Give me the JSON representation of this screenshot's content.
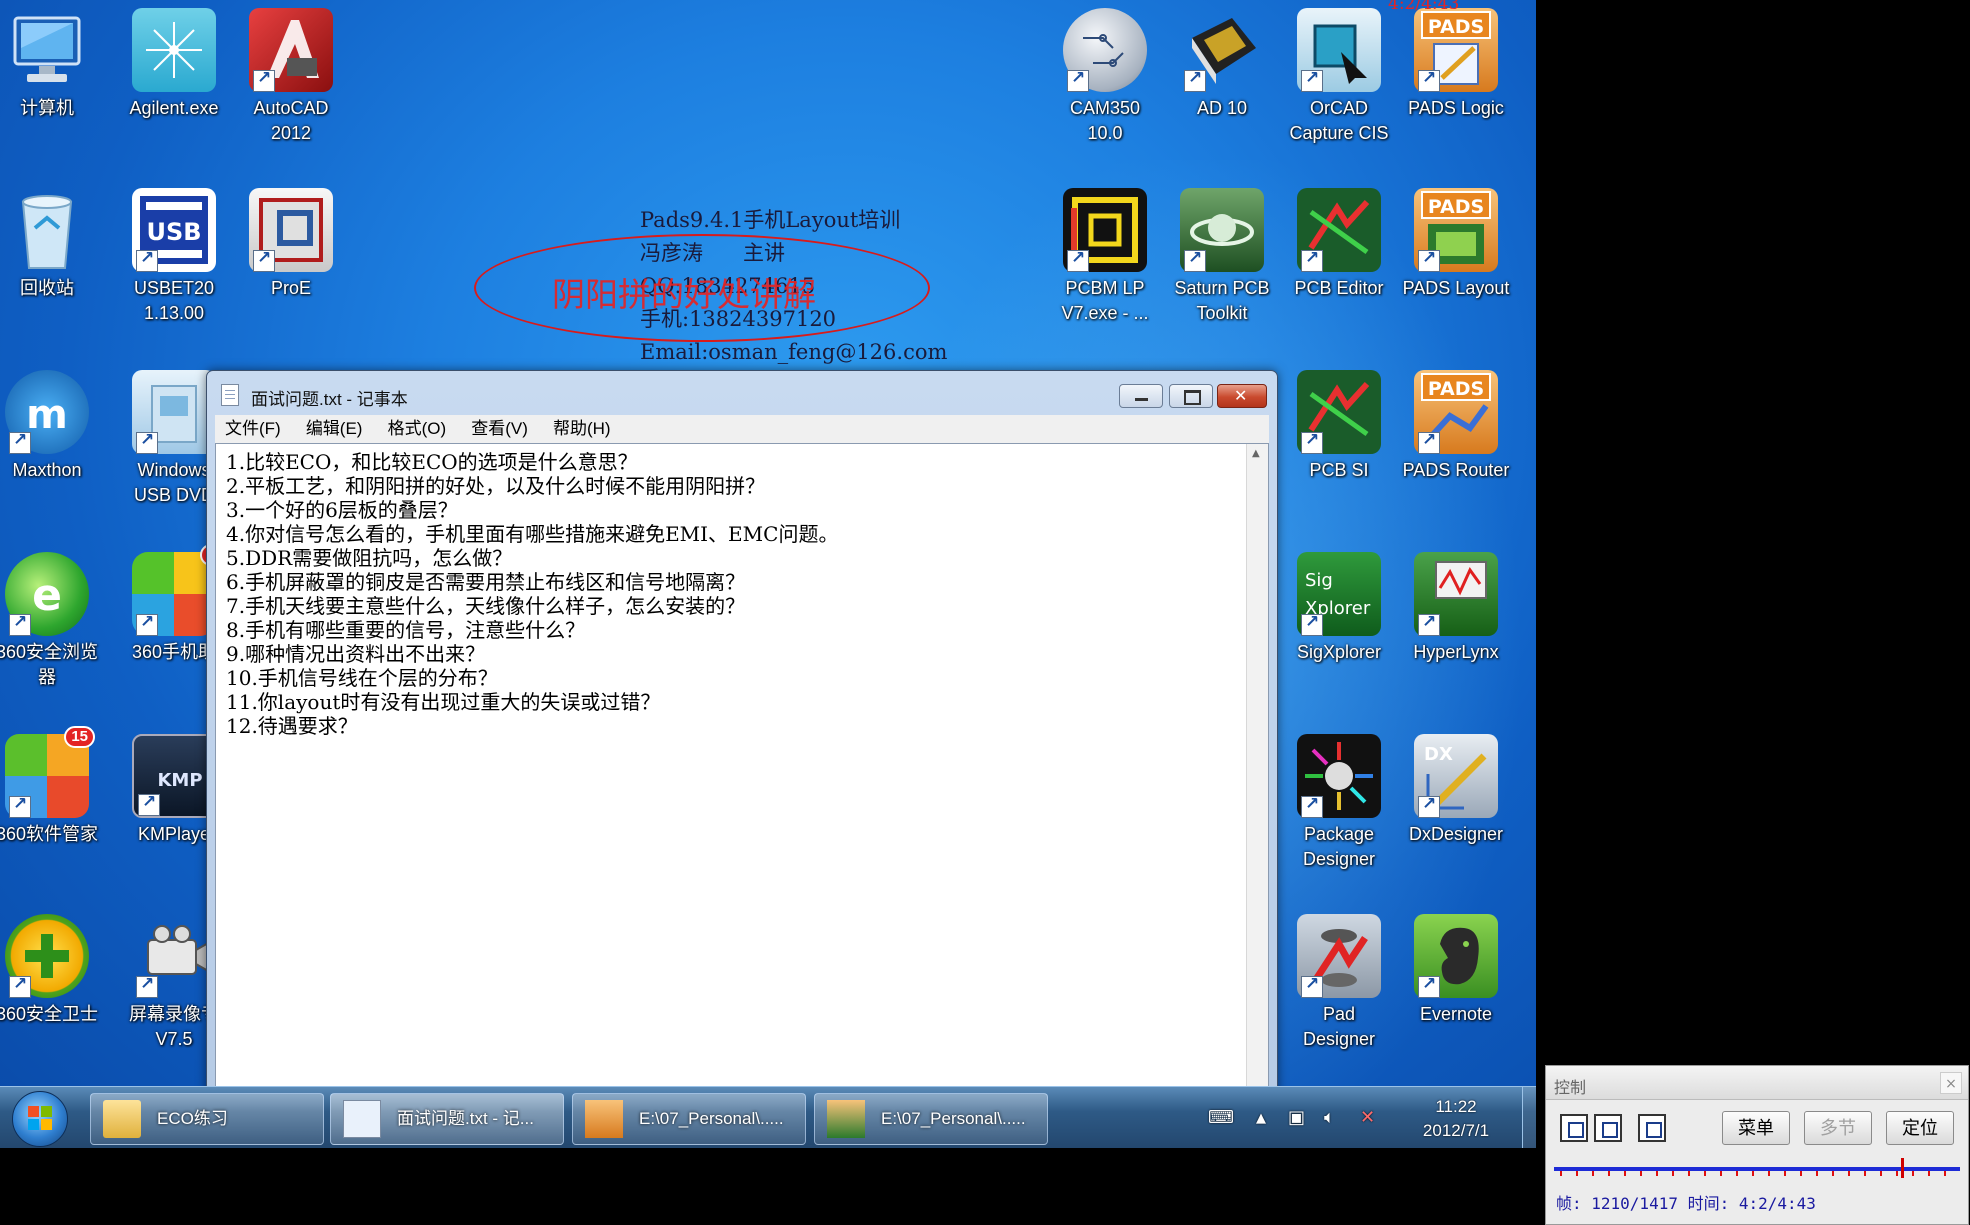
{
  "desktop": {
    "icons": [
      {
        "name": "computer",
        "label": "计算机"
      },
      {
        "name": "agilent",
        "label": "Agilent.exe"
      },
      {
        "name": "autocad",
        "label": "AutoCAD\n2012"
      },
      {
        "name": "recycle-bin",
        "label": "回收站"
      },
      {
        "name": "usbet",
        "label": "USBET20\n1.13.00"
      },
      {
        "name": "proe",
        "label": "ProE"
      },
      {
        "name": "maxthon",
        "label": "Maxthon"
      },
      {
        "name": "windows-usb-dvd",
        "label": "Windows\nUSB DVD"
      },
      {
        "name": "360-browser",
        "label": "360安全浏览\n器"
      },
      {
        "name": "360-phone",
        "label": "360手机助"
      },
      {
        "name": "360-software",
        "label": "360软件管家"
      },
      {
        "name": "kmplayer",
        "label": "KMPlaye"
      },
      {
        "name": "360-guard",
        "label": "360安全卫士"
      },
      {
        "name": "screen-recorder",
        "label": "屏幕录像专\nV7.5"
      },
      {
        "name": "cam350",
        "label": "CAM350\n10.0"
      },
      {
        "name": "ad10",
        "label": "AD 10"
      },
      {
        "name": "orcad",
        "label": "OrCAD\nCapture CIS"
      },
      {
        "name": "pads-logic",
        "label": "PADS Logic"
      },
      {
        "name": "pcbm-lp",
        "label": "PCBM LP\nV7.exe - ..."
      },
      {
        "name": "saturn-pcb",
        "label": "Saturn PCB\nToolkit"
      },
      {
        "name": "pcb-editor",
        "label": "PCB Editor"
      },
      {
        "name": "pads-layout",
        "label": "PADS Layout"
      },
      {
        "name": "pcb-si",
        "label": "PCB SI"
      },
      {
        "name": "pads-router",
        "label": "PADS Router"
      },
      {
        "name": "sigxplorer",
        "label": "SigXplorer"
      },
      {
        "name": "hyperlynx",
        "label": "HyperLynx"
      },
      {
        "name": "package-designer",
        "label": "Package\nDesigner"
      },
      {
        "name": "dxdesigner",
        "label": "DxDesigner"
      },
      {
        "name": "pad-designer",
        "label": "Pad\nDesigner"
      },
      {
        "name": "evernote",
        "label": "Evernote"
      }
    ],
    "badges": {
      "phone": "1",
      "software": "15"
    }
  },
  "overlay": {
    "training_lines": [
      "Pads9.4.1手机Layout培训",
      "冯彦涛      主讲",
      "QQ:1834274615",
      "手机:13824397120",
      "Email:osman_feng@126.com"
    ],
    "oval_text": "阴阳拼的好处讲解",
    "red_timestamp": "4:2/4:43"
  },
  "notepad": {
    "title": "面试问题.txt - 记事本",
    "menu": [
      "文件(F)",
      "编辑(E)",
      "格式(O)",
      "查看(V)",
      "帮助(H)"
    ],
    "lines": [
      "1.比较ECO，和比较ECO的选项是什么意思？",
      "2.平板工艺，和阴阳拼的好处，以及什么时候不能用阴阳拼？",
      "3.一个好的6层板的叠层？",
      "4.你对信号怎么看的，手机里面有哪些措施来避免EMI、EMC问题。",
      "5.DDR需要做阻抗吗，怎么做？",
      "6.手机屏蔽罩的铜皮是否需要用禁止布线区和信号地隔离？",
      "7.手机天线要主意些什么，天线像什么样子，怎么安装的？",
      "8.手机有哪些重要的信号，注意些什么？",
      "9.哪种情况出资料出不出来？",
      "10.手机信号线在个层的分布？",
      "11.你layout时有没有出现过重大的失误或过错？",
      "12.待遇要求？"
    ]
  },
  "taskbar": {
    "tasks": [
      {
        "label": "ECO练习"
      },
      {
        "label": "面试问题.txt - 记..."
      },
      {
        "label": "E:\\07_Personal\\....."
      },
      {
        "label": "E:\\07_Personal\\....."
      }
    ],
    "time": "11:22",
    "date": "2012/7/1"
  },
  "control": {
    "title": "控制",
    "menu_label": "菜单",
    "multi_label": "多节",
    "locate_label": "定位",
    "status": "帧: 1210/1417 时间: 4:2/4:43",
    "progress": 0.854
  }
}
